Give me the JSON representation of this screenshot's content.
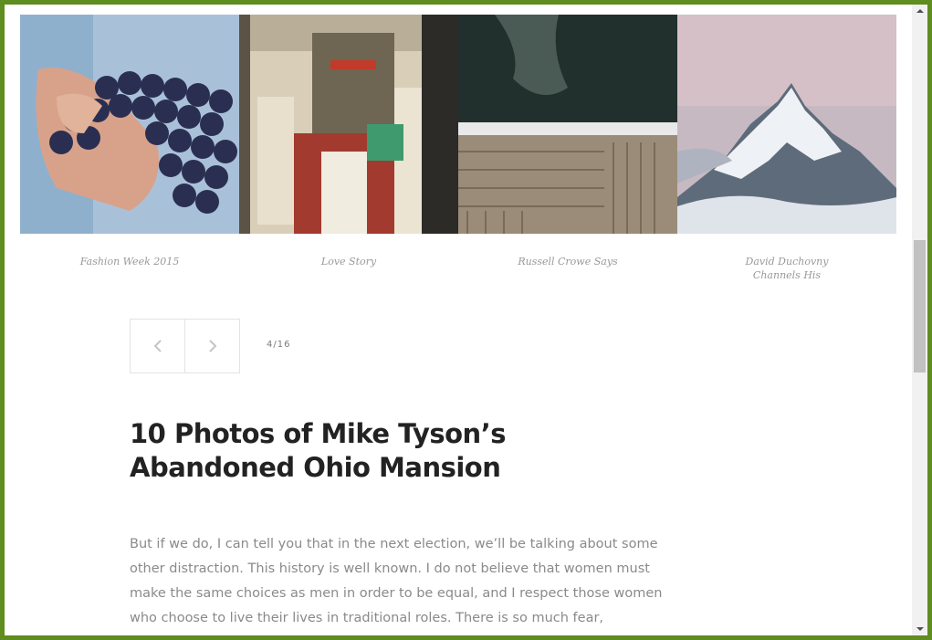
{
  "gallery": {
    "items": [
      {
        "caption": "Fashion Week 2015",
        "image": "grapes-in-hand"
      },
      {
        "caption": "Love Story",
        "image": "tram-interior"
      },
      {
        "caption": "Russell Crowe Says",
        "image": "boardwalk-water"
      },
      {
        "caption": "David Duchovny Channels His",
        "image": "snowy-mountain"
      }
    ]
  },
  "pager": {
    "prev_icon": "chevron-left-icon",
    "next_icon": "chevron-right-icon",
    "count": "4/16"
  },
  "article": {
    "title": "10 Photos of Mike Tyson’s Abandoned Ohio Mansion",
    "body": "But if we do, I can tell you that in the next election, we’ll be talking about some other distraction. This history is well known. I do not believe that women must make the same choices as men in order to be equal, and I respect those women who choose to live their lives in traditional roles. There is so much fear,"
  },
  "colors": {
    "window_border": "#5f8d1f",
    "caption": "#999999",
    "headline": "#222222",
    "body": "#8a8a8a"
  }
}
